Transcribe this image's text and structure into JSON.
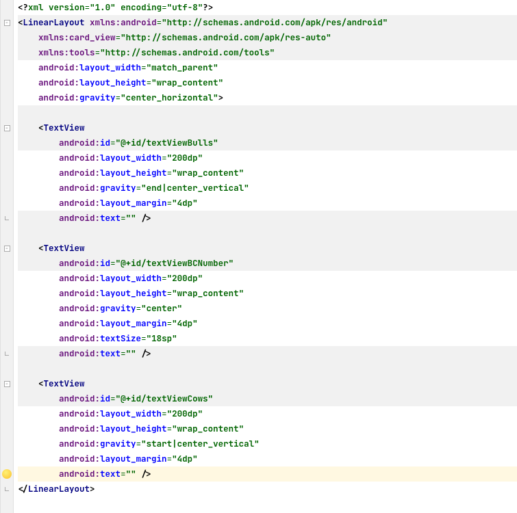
{
  "xml_decl": {
    "version": "1.0",
    "encoding": "utf-8"
  },
  "root": {
    "tag": "LinearLayout",
    "xmlns_android": "http://schemas.android.com/apk/res/android",
    "xmlns_card_view": "http://schemas.android.com/apk/res-auto",
    "xmlns_tools": "http://schemas.android.com/tools",
    "layout_width": "match_parent",
    "layout_height": "wrap_content",
    "gravity": "center_horizontal"
  },
  "textview1": {
    "tag": "TextView",
    "id": "@+id/textViewBulls",
    "layout_width": "200dp",
    "layout_height": "wrap_content",
    "gravity": "end|center_vertical",
    "layout_margin": "4dp",
    "text": ""
  },
  "textview2": {
    "tag": "TextView",
    "id": "@+id/textViewBCNumber",
    "layout_width": "200dp",
    "layout_height": "wrap_content",
    "gravity": "center",
    "layout_margin": "4dp",
    "textSize": "18sp",
    "text": ""
  },
  "textview3": {
    "tag": "TextView",
    "id": "@+id/textViewCows",
    "layout_width": "200dp",
    "layout_height": "wrap_content",
    "gravity": "start|center_vertical",
    "layout_margin": "4dp",
    "text": ""
  },
  "tokens": {
    "xmlns": "xmlns",
    "android": "android",
    "card_view": "card_view",
    "tools": "tools",
    "layout_width": "layout_width",
    "layout_height": "layout_height",
    "gravity": "gravity",
    "id": "id",
    "layout_margin": "layout_margin",
    "text": "text",
    "textSize": "textSize",
    "version": "version",
    "encoding": "encoding",
    "xml": "xml"
  }
}
